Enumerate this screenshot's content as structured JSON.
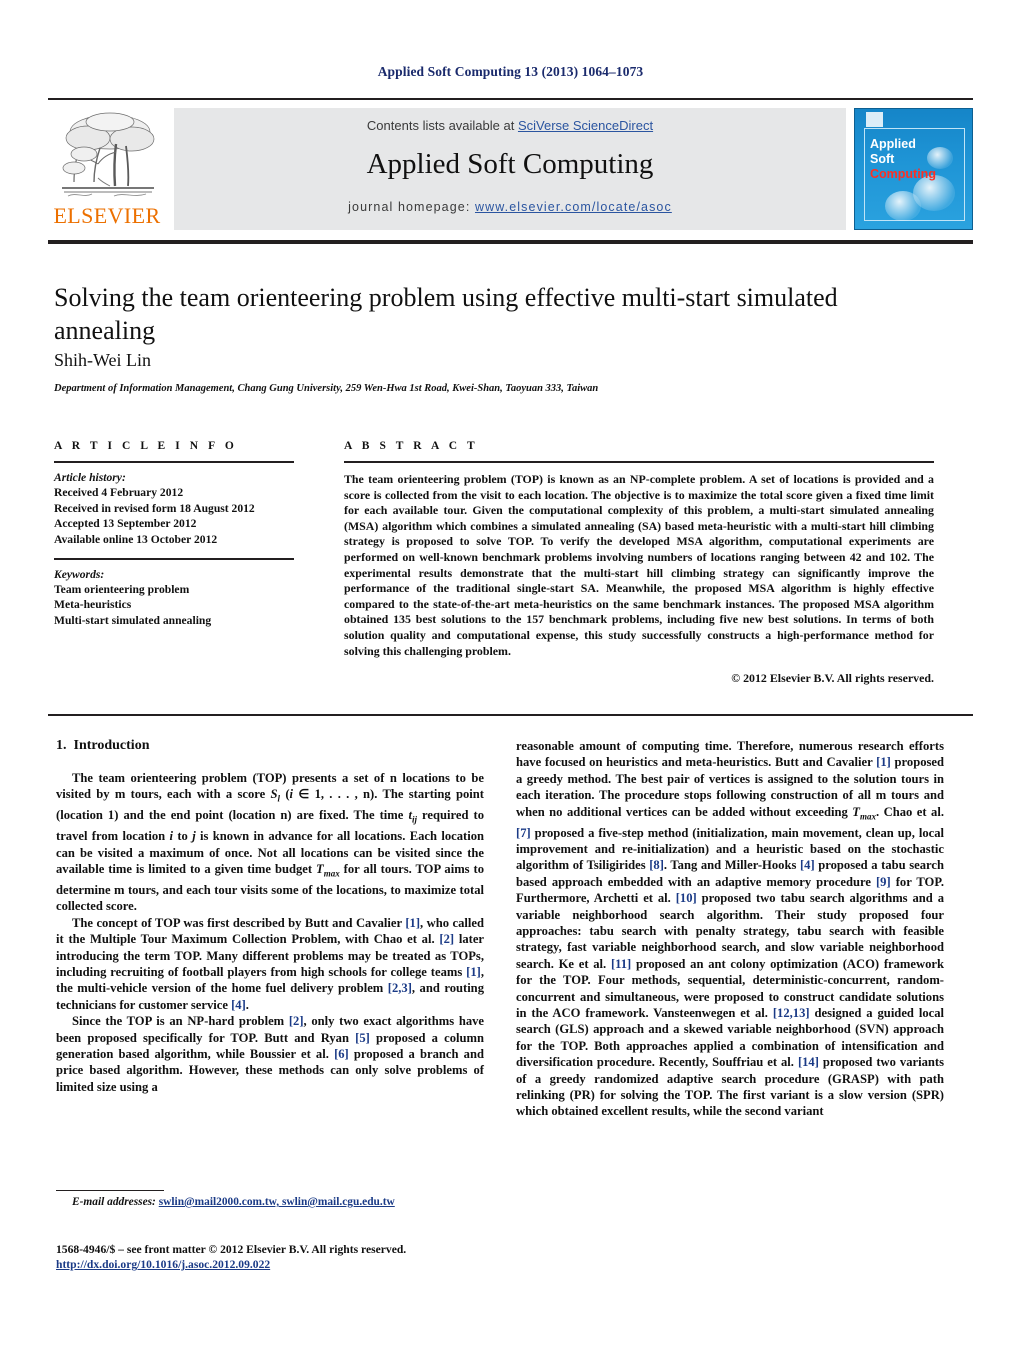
{
  "running_head": "Applied Soft Computing 13 (2013) 1064–1073",
  "header": {
    "contents_prefix": "Contents lists available at ",
    "contents_link": "SciVerse ScienceDirect",
    "journal_name": "Applied Soft Computing",
    "homepage_prefix": "journal homepage: ",
    "homepage_url": "www.elsevier.com/locate/asoc",
    "publisher": "ELSEVIER",
    "cover": {
      "line1": "Applied",
      "line2": "Soft",
      "line3": "Computing"
    }
  },
  "article": {
    "title": "Solving the team orienteering problem using effective multi-start simulated annealing",
    "author": "Shih-Wei Lin",
    "affiliation": "Department of Information Management, Chang Gung University, 259 Wen-Hwa 1st Road, Kwei-Shan, Taoyuan 333, Taiwan"
  },
  "article_info": {
    "heading": "A R T I C L E   I N F O",
    "history_label": "Article history:",
    "history": [
      "Received 4 February 2012",
      "Received in revised form 18 August 2012",
      "Accepted 13 September 2012",
      "Available online 13 October 2012"
    ],
    "keywords_label": "Keywords:",
    "keywords": [
      "Team orienteering problem",
      "Meta-heuristics",
      "Multi-start simulated annealing"
    ]
  },
  "abstract": {
    "heading": "A B S T R A C T",
    "text": "The team orienteering problem (TOP) is known as an NP-complete problem. A set of locations is provided and a score is collected from the visit to each location. The objective is to maximize the total score given a fixed time limit for each available tour. Given the computational complexity of this problem, a multi-start simulated annealing (MSA) algorithm which combines a simulated annealing (SA) based meta-heuristic with a multi-start hill climbing strategy is proposed to solve TOP. To verify the developed MSA algorithm, computational experiments are performed on well-known benchmark problems involving numbers of locations ranging between 42 and 102. The experimental results demonstrate that the multi-start hill climbing strategy can significantly improve the performance of the traditional single-start SA. Meanwhile, the proposed MSA algorithm is highly effective compared to the state-of-the-art meta-heuristics on the same benchmark instances. The proposed MSA algorithm obtained 135 best solutions to the 157 benchmark problems, including five new best solutions. In terms of both solution quality and computational expense, this study successfully constructs a high-performance method for solving this challenging problem.",
    "copyright": "© 2012 Elsevier B.V. All rights reserved."
  },
  "section": {
    "number": "1.",
    "title": "Introduction"
  },
  "footnote": {
    "email_label": "E-mail addresses:",
    "emails": "swlin@mail2000.com.tw, swlin@mail.cgu.edu.tw"
  },
  "imprint": {
    "line1": "1568-4946/$ – see front matter © 2012 Elsevier B.V. All rights reserved.",
    "doi": "http://dx.doi.org/10.1016/j.asoc.2012.09.022"
  }
}
